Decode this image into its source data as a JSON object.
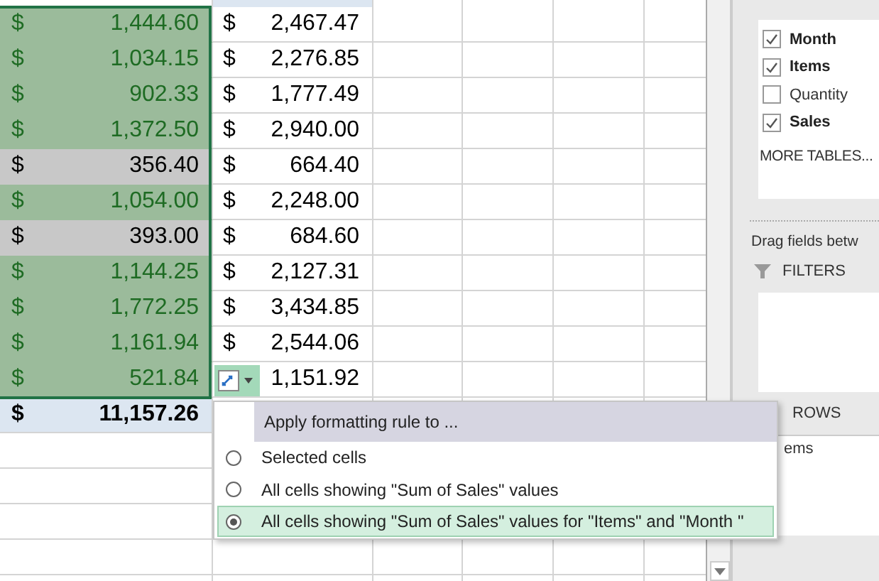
{
  "sheet": {
    "rows": [
      {
        "a": "1,444.60",
        "b": "2,467.47",
        "kind": "good"
      },
      {
        "a": "1,034.15",
        "b": "2,276.85",
        "kind": "good"
      },
      {
        "a": "902.33",
        "b": "1,777.49",
        "kind": "good"
      },
      {
        "a": "1,372.50",
        "b": "2,940.00",
        "kind": "good"
      },
      {
        "a": "356.40",
        "b": "664.40",
        "kind": "neutral"
      },
      {
        "a": "1,054.00",
        "b": "2,248.00",
        "kind": "good"
      },
      {
        "a": "393.00",
        "b": "684.60",
        "kind": "neutral"
      },
      {
        "a": "1,144.25",
        "b": "2,127.31",
        "kind": "good"
      },
      {
        "a": "1,772.25",
        "b": "3,434.85",
        "kind": "good"
      },
      {
        "a": "1,161.94",
        "b": "2,544.06",
        "kind": "good"
      },
      {
        "a": "521.84",
        "b": "1,151.92",
        "kind": "good"
      }
    ],
    "currency": "$",
    "total": "11,157.26"
  },
  "popup": {
    "title": "Apply formatting rule to ...",
    "options": [
      {
        "label": "Selected cells",
        "selected": false
      },
      {
        "label": "All cells showing \"Sum of Sales\" values",
        "selected": false
      },
      {
        "label": "All cells showing \"Sum of Sales\" values for \"Items\" and \"Month \"",
        "selected": true
      }
    ]
  },
  "panel": {
    "fields": [
      {
        "label": "Month",
        "checked": true
      },
      {
        "label": "Items",
        "checked": true
      },
      {
        "label": "Quantity",
        "checked": false
      },
      {
        "label": "Sales",
        "checked": true
      }
    ],
    "more_tables": "MORE TABLES...",
    "hint": "Drag fields betw",
    "filters": "FILTERS",
    "rows_header": "ROWS",
    "rows_items": [
      "ems"
    ]
  }
}
